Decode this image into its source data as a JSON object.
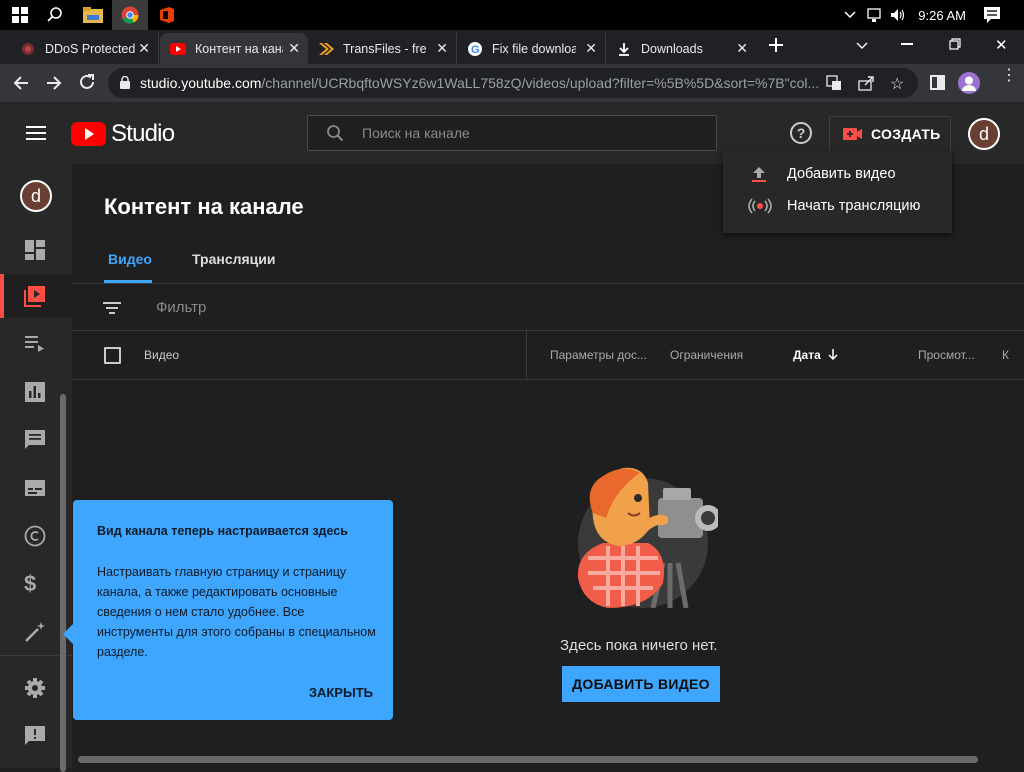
{
  "taskbar": {
    "time": "9:26 AM"
  },
  "browser": {
    "tabs": [
      {
        "title": "DDoS Protected",
        "active": false
      },
      {
        "title": "Контент на канале",
        "active": true
      },
      {
        "title": "TransFiles - free",
        "active": false
      },
      {
        "title": "Fix file download",
        "active": false
      },
      {
        "title": "Downloads",
        "active": false
      }
    ],
    "url_host": "studio.youtube.com",
    "url_rest": "/channel/UCRbqftoWSYz6w1WaLL758zQ/videos/upload?filter=%5B%5D&sort=%7B\"col..."
  },
  "app": {
    "logo_text": "Studio",
    "search_placeholder": "Поиск на канале",
    "create_label": "СОЗДАТЬ",
    "avatar_letter": "d"
  },
  "create_menu": {
    "items": [
      {
        "label": "Добавить видео"
      },
      {
        "label": "Начать трансляцию"
      }
    ]
  },
  "main": {
    "title": "Контент на канале",
    "tabs": [
      {
        "label": "Видео"
      },
      {
        "label": "Трансляции"
      }
    ],
    "filter_label": "Фильтр",
    "columns": [
      "Видео",
      "Параметры дос...",
      "Ограничения",
      "Дата",
      "Просмот...",
      "К"
    ],
    "empty_text": "Здесь пока ничего нет.",
    "add_video_label": "ДОБАВИТЬ ВИДЕО"
  },
  "tooltip": {
    "title": "Вид канала теперь настраивается здесь",
    "body": "Настраивать главную страницу и страницу канала, а также редактировать основные сведения о нем стало удобнее. Все инструменты для этого собраны в специальном разделе.",
    "close_label": "ЗАКРЫТЬ"
  },
  "colors": {
    "accent": "#3ea6ff",
    "brand_red": "#ff0000",
    "background": "#1f1f1f"
  }
}
